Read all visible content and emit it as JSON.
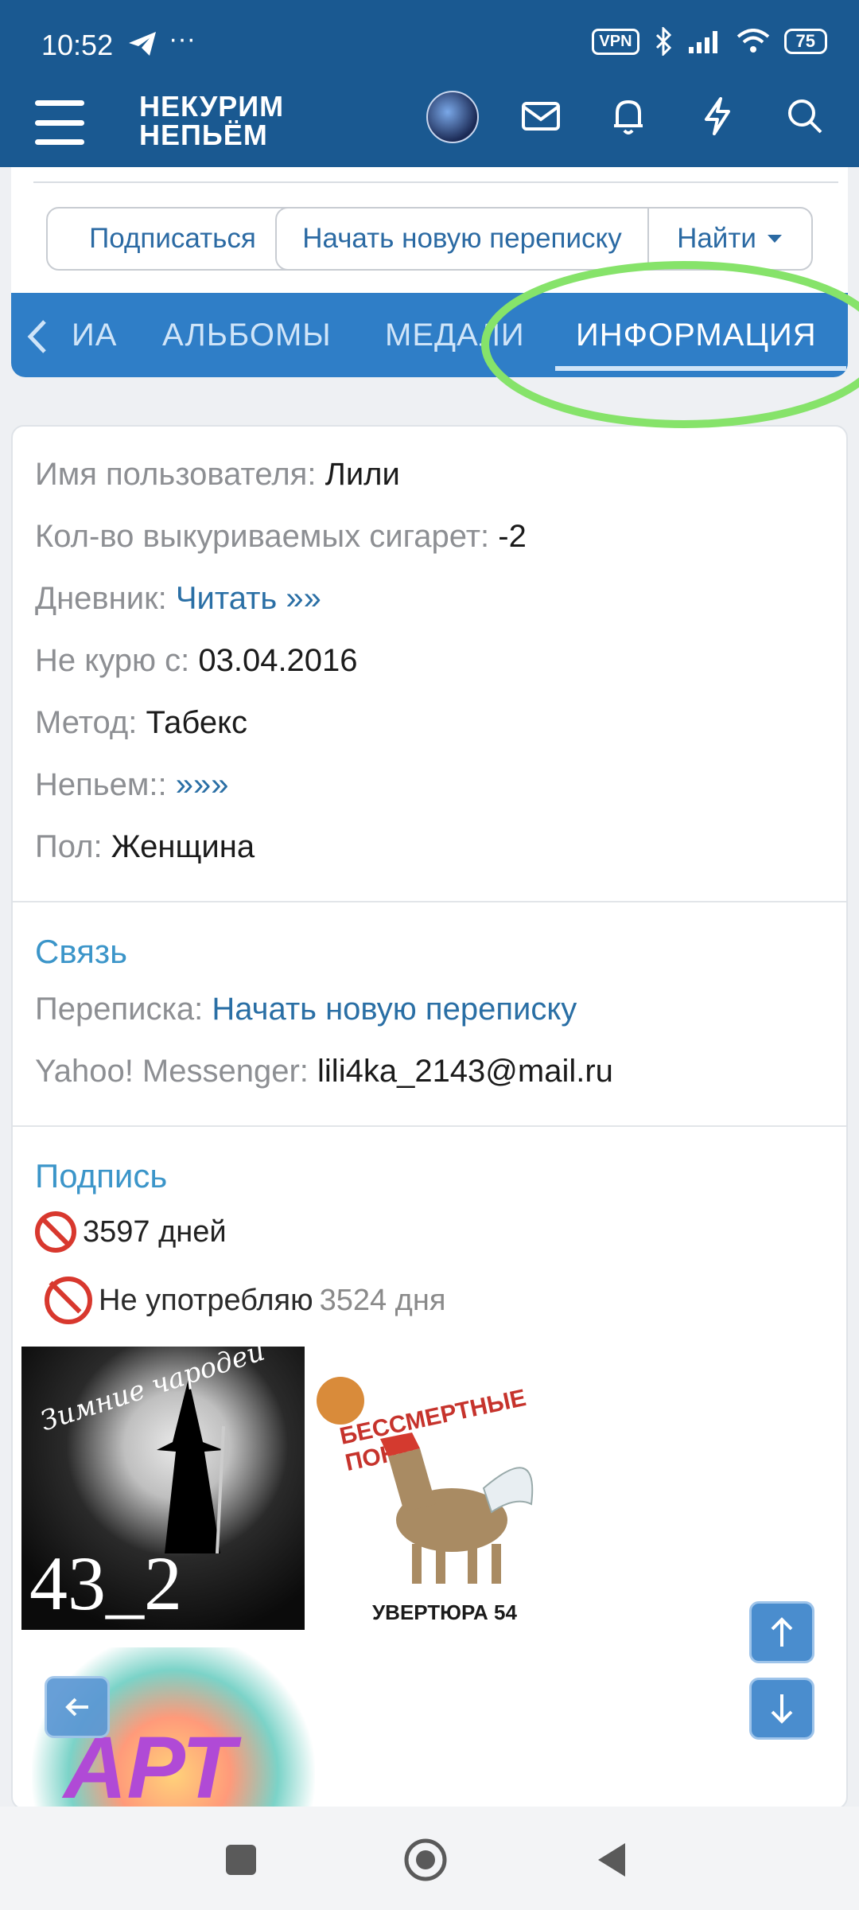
{
  "status_bar": {
    "time": "10:52",
    "vpn": "VPN",
    "battery": "75"
  },
  "header": {
    "logo_line1": "НЕКУРИМ",
    "logo_line2": "НЕПЬЁМ"
  },
  "profile_buttons": {
    "subscribe": "Подписаться",
    "new_conversation": "Начать новую переписку",
    "find": "Найти"
  },
  "tabs": [
    {
      "label": "ИА"
    },
    {
      "label": "АЛЬБОМЫ"
    },
    {
      "label": "МЕДАЛИ"
    },
    {
      "label": "ИНФОРМАЦИЯ"
    }
  ],
  "info": [
    {
      "label": "Имя пользователя:",
      "value": "Лили"
    },
    {
      "label": "Кол-во выкуриваемых сигарет:",
      "value": "-2"
    },
    {
      "label": "Дневник:",
      "value": "Читать »»"
    },
    {
      "label": "Не курю с:",
      "value": "03.04.2016"
    },
    {
      "label": "Метод:",
      "value": "Табекс"
    },
    {
      "label": "Непьем::",
      "value": "»»»"
    },
    {
      "label": "Пол:",
      "value": "Женщина"
    }
  ],
  "contact": {
    "heading": "Связь",
    "conversation_label": "Переписка:",
    "conversation_link": "Начать новую переписку",
    "yahoo_label": "Yahoo! Messenger:",
    "yahoo_value": "lili4ka_2143@mail.ru"
  },
  "signature": {
    "heading": "Подпись",
    "line1": "3597 дней",
    "line2_text": "Не употребляю",
    "line2_count": "3524 дня",
    "img1_arc": "Зимние чародеи",
    "img1_caption": "43_2",
    "img2_arc": "БЕССМЕРТНЫЕ ПОНИ",
    "img2_caption": "УВЕРТЮРА 54",
    "img3_caption": "АРТ"
  }
}
